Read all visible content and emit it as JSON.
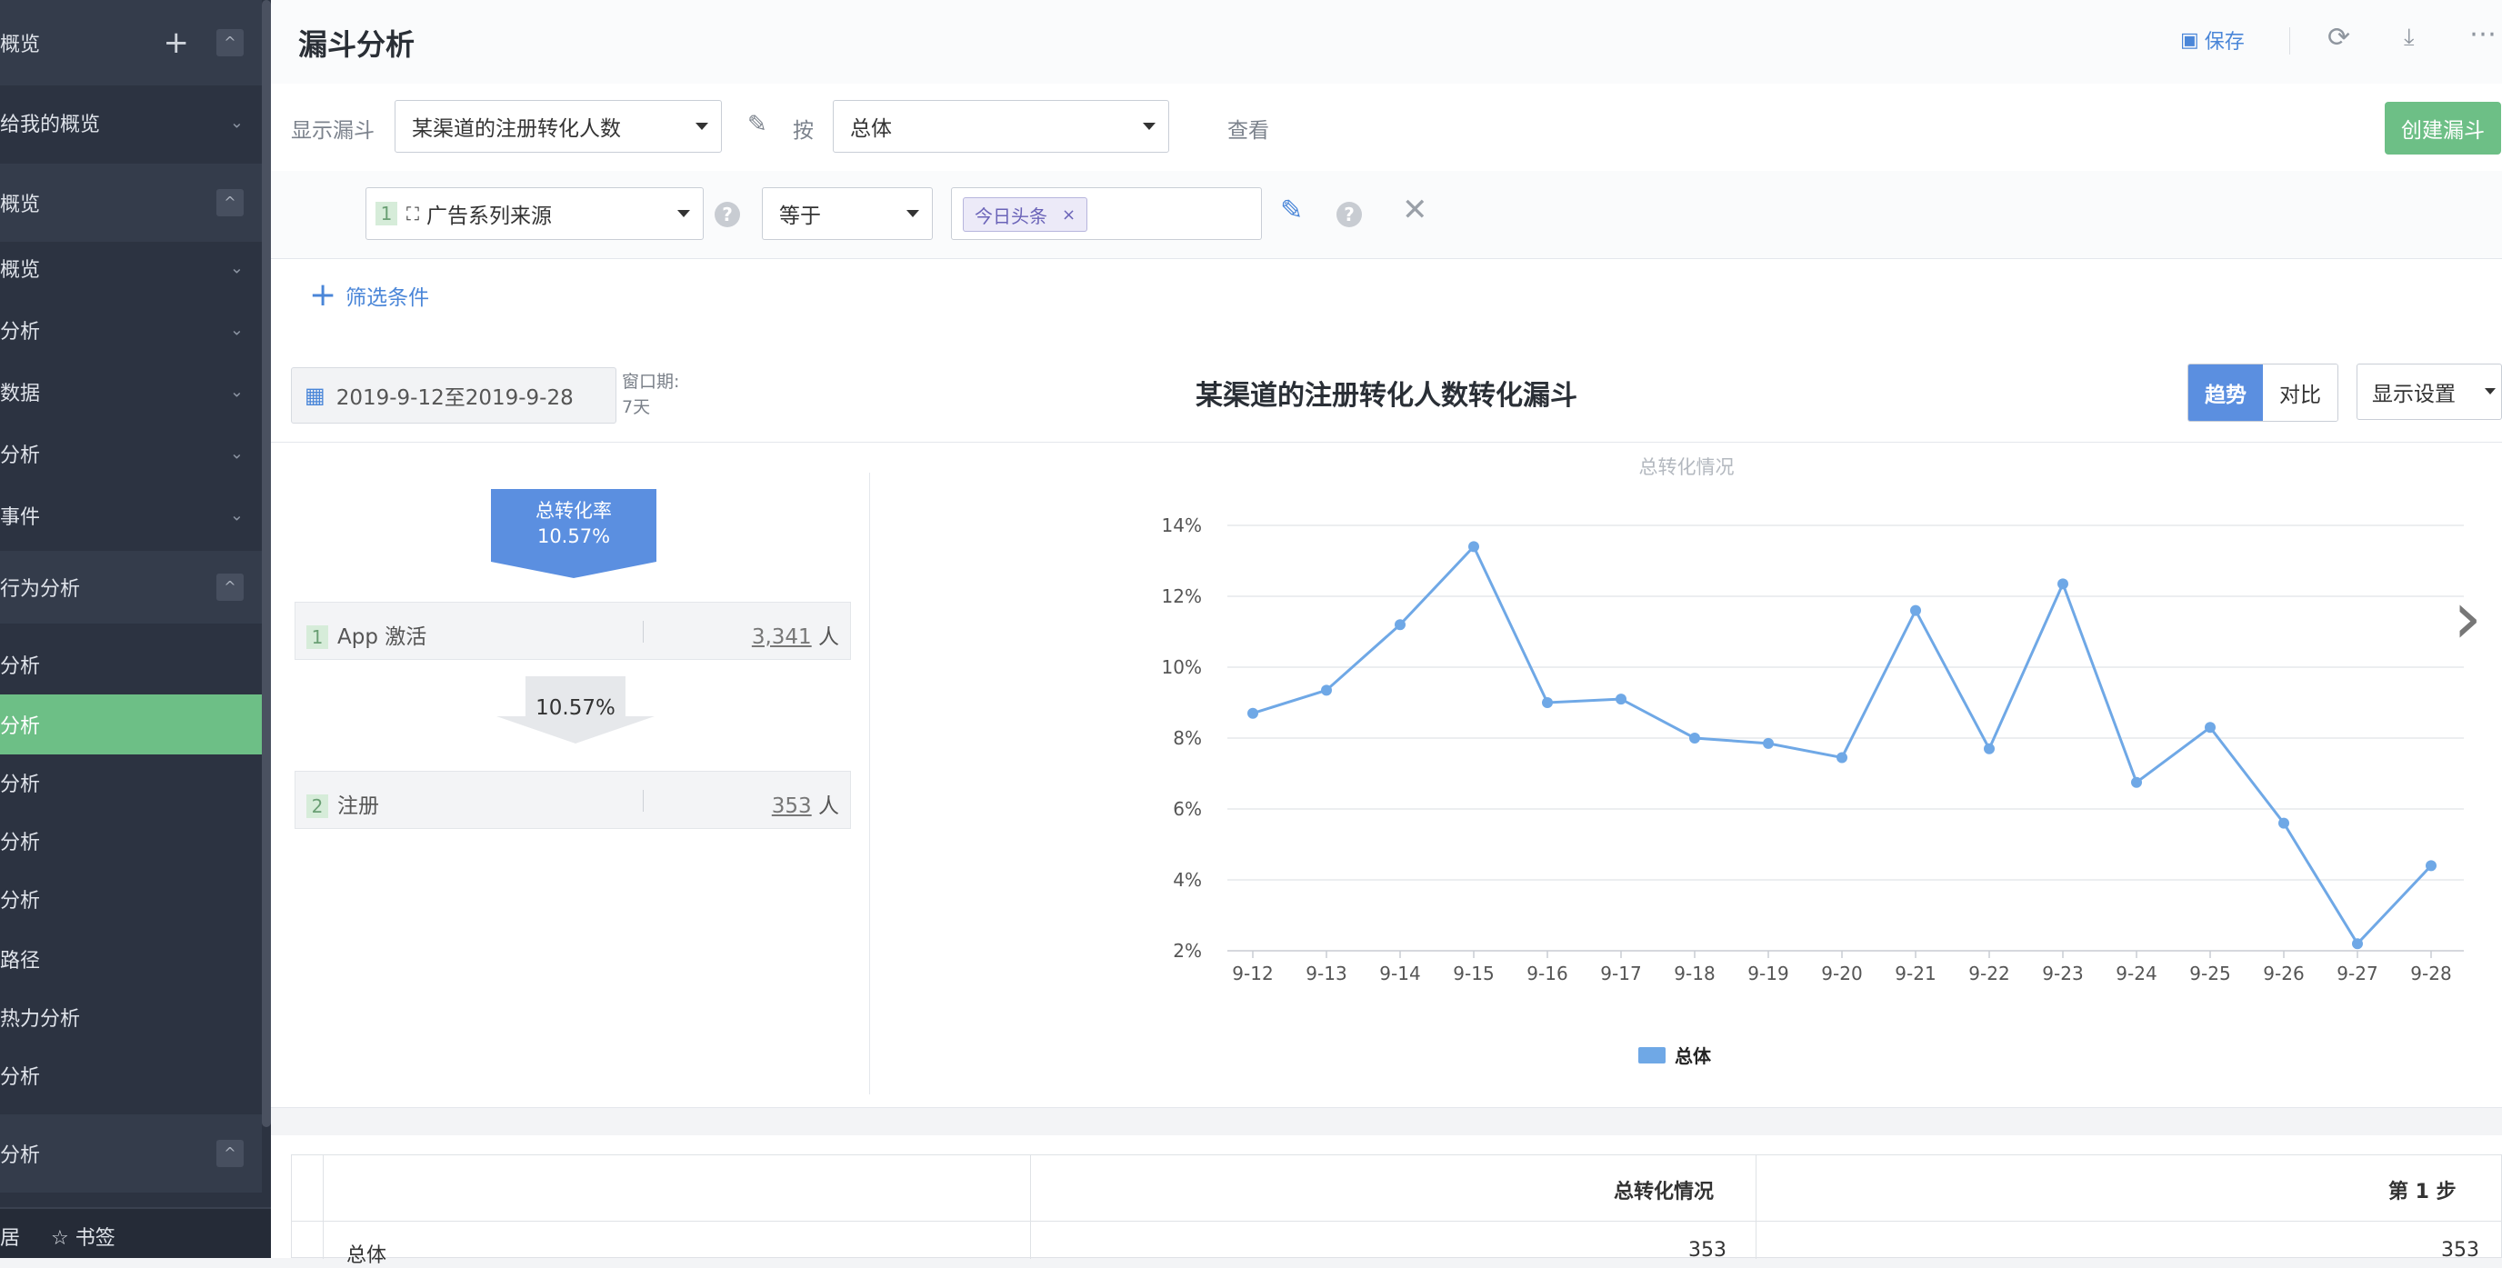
{
  "sidebar": {
    "sections": [
      {
        "label": "概览",
        "control": "^"
      },
      {
        "label": "给我的概览",
        "control": "v"
      },
      {
        "label": "概览",
        "control": "^"
      },
      {
        "label": "概览",
        "control": "v"
      },
      {
        "label": "分析",
        "control": "v"
      },
      {
        "label": "数据",
        "control": "v"
      },
      {
        "label": "分析",
        "control": "v"
      },
      {
        "label": "事件",
        "control": "v"
      },
      {
        "label": "行为分析",
        "control": "^"
      },
      {
        "label": "分析"
      },
      {
        "label": "分析"
      },
      {
        "label": "分析"
      },
      {
        "label": "分析"
      },
      {
        "label": "分析"
      },
      {
        "label": "路径"
      },
      {
        "label": "热力分析"
      },
      {
        "label": "分析"
      },
      {
        "label": "分析",
        "control": "^"
      }
    ],
    "bottom": {
      "left_label": "居",
      "bookmark_label": "☆ 书签"
    }
  },
  "header": {
    "title": "漏斗分析",
    "save_label": "保存"
  },
  "funnel_row": {
    "show_label": "显示漏斗",
    "funnel_select": "某渠道的注册转化人数",
    "by_label": "按",
    "group_select": "总体",
    "view_label": "查看",
    "create_label": "创建漏斗"
  },
  "filter_row": {
    "index": "1",
    "property": "广告系列来源",
    "operator": "等于",
    "tag": "今日头条"
  },
  "add_filter_label": "筛选条件",
  "chart_header": {
    "date_range": "2019-9-12至2019-9-28",
    "window_label": "窗口期:",
    "window_value": "7天",
    "title": "某渠道的注册转化人数转化漏斗",
    "tab_trend": "趋势",
    "tab_compare": "对比",
    "display_settings": "显示设置"
  },
  "funnel": {
    "total_rate_label": "总转化率",
    "total_rate_value": "10.57%",
    "steps": [
      {
        "index": "1",
        "name": "App 激活",
        "count": "3,341",
        "unit": "人"
      },
      {
        "index": "2",
        "name": "注册",
        "count": "353",
        "unit": "人"
      }
    ],
    "step_conversion": "10.57%"
  },
  "chart_data": {
    "type": "line",
    "title": "总转化情况",
    "categories": [
      "9-12",
      "9-13",
      "9-14",
      "9-15",
      "9-16",
      "9-17",
      "9-18",
      "9-19",
      "9-20",
      "9-21",
      "9-22",
      "9-23",
      "9-24",
      "9-25",
      "9-26",
      "9-27",
      "9-28"
    ],
    "series": [
      {
        "name": "总体",
        "color": "#6fa8e6",
        "values": [
          8.7,
          9.35,
          11.2,
          13.4,
          9.0,
          9.1,
          8.0,
          7.85,
          7.45,
          11.6,
          7.7,
          12.35,
          6.75,
          8.3,
          5.6,
          2.2,
          4.4
        ]
      }
    ],
    "y_ticks": [
      "2%",
      "4%",
      "6%",
      "8%",
      "10%",
      "12%",
      "14%"
    ],
    "ylim": [
      2,
      14
    ],
    "y_unit": "%",
    "grid": true,
    "legend": "bottom-center"
  },
  "table": {
    "headers": [
      "",
      "总转化情况",
      "第 1 步"
    ],
    "row": [
      "总体",
      "353",
      "353"
    ]
  }
}
